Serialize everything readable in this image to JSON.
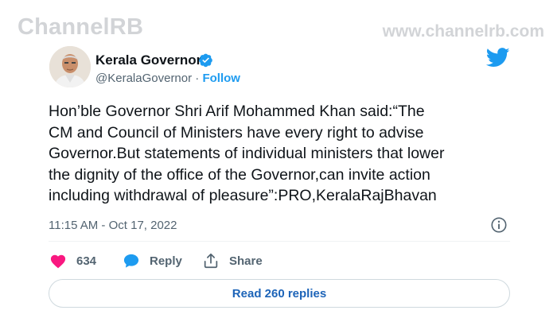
{
  "watermark": {
    "left": "ChannelRB",
    "right": "www.channelrb.com"
  },
  "tweet": {
    "author_name": "Kerala Governor",
    "handle": "@KeralaGovernor",
    "separator": "·",
    "follow_label": "Follow",
    "text": "Hon’ble Governor Shri Arif Mohammed Khan said:“The\nCM and Council of Ministers have every right to advise\nGovernor.But statements of individual ministers that lower\nthe dignity of the office of the Governor,can invite action\nincluding withdrawal of pleasure”:PRO,KeralaRajBhavan",
    "timestamp": "11:15 AM - Oct 17, 2022"
  },
  "actions": {
    "like_count": "634",
    "reply_label": "Reply",
    "share_label": "Share"
  },
  "read_replies_label": "Read 260 replies",
  "colors": {
    "accent": "#1d9bf0",
    "like": "#f91880",
    "text": "#0f1419",
    "muted": "#536471",
    "watermark": "#d2d4d7"
  },
  "icons": [
    "verified-badge-icon",
    "twitter-bird-icon",
    "info-icon",
    "heart-icon",
    "reply-bubble-icon",
    "share-icon"
  ]
}
